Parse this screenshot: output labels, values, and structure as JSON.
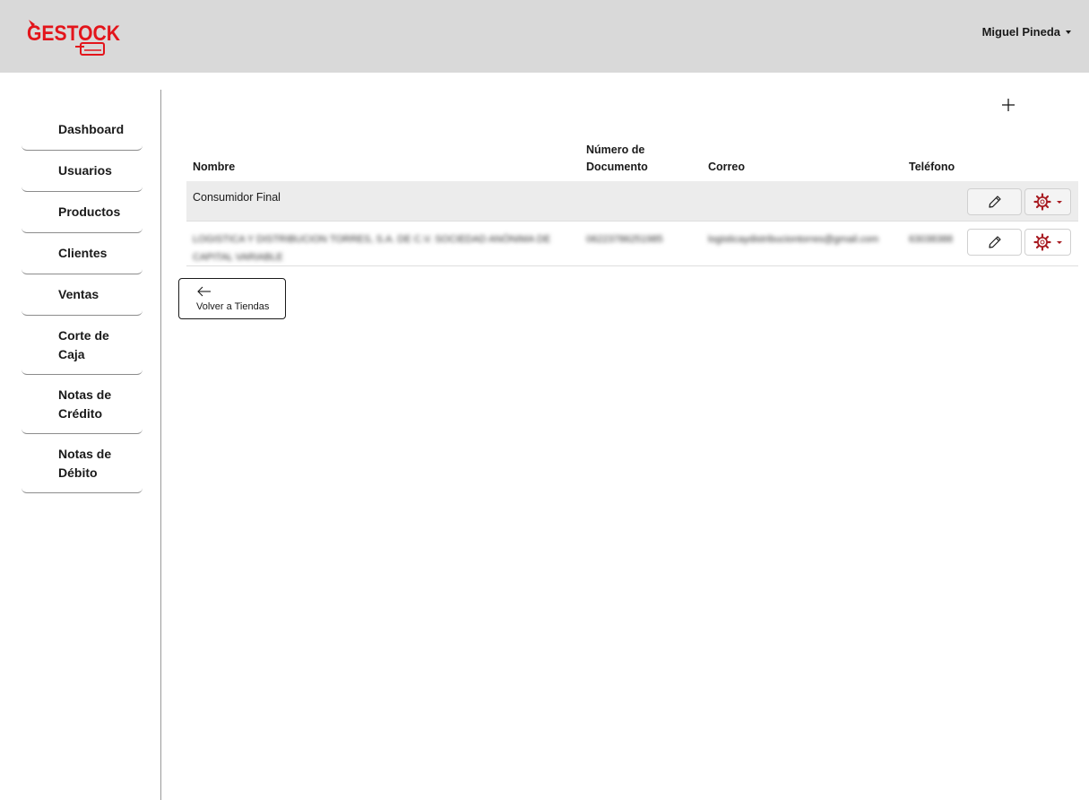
{
  "header": {
    "logo_text": "GESTOCK",
    "user_name": "Miguel Pineda"
  },
  "sidebar": {
    "items": [
      {
        "label": "Dashboard"
      },
      {
        "label": "Usuarios"
      },
      {
        "label": "Productos"
      },
      {
        "label": "Clientes"
      },
      {
        "label": "Ventas"
      },
      {
        "label": "Corte de\nCaja"
      },
      {
        "label": "Notas de\nCrédito"
      },
      {
        "label": "Notas de\nDébito"
      }
    ]
  },
  "table": {
    "columns": {
      "nombre": "Nombre",
      "documento": "Número de\nDocumento",
      "correo": "Correo",
      "telefono": "Teléfono"
    },
    "rows": [
      {
        "nombre": "Consumidor Final",
        "documento": "",
        "correo": "",
        "telefono": ""
      },
      {
        "nombre": "LOGISTICA Y DISTRIBUCION TORRES, S.A. DE C.V. SOCIEDAD ANÓNIMA DE CAPITAL VARIABLE",
        "documento": "06223786251985",
        "correo": "logisticaydistribuciontorres@gmail.com",
        "telefono": "63038388"
      }
    ]
  },
  "back_button": {
    "label": "Volver a Tiendas"
  },
  "colors": {
    "brand_red": "#e3151b",
    "gear_red": "#a81c22",
    "header_bg": "#d9d9d9"
  },
  "icons": {
    "add": "plus-icon",
    "edit": "pencil-icon",
    "settings": "gear-icon",
    "back": "arrow-left-icon"
  }
}
